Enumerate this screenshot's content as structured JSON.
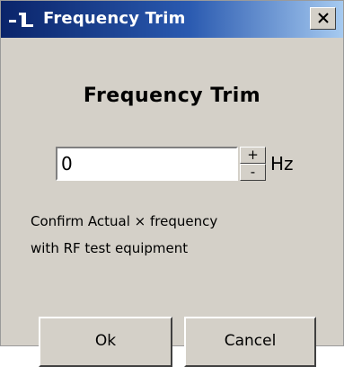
{
  "window": {
    "title": "Frequency Trim",
    "icon": "radio-app-icon",
    "close_icon": "close-x-icon"
  },
  "dialog": {
    "heading": "Frequency Trim",
    "input_value": "0",
    "spin_up": "+",
    "spin_down": "-",
    "unit": "Hz",
    "message_line1": "Confirm Actual  × frequency",
    "message_line2": "with RF test equipment"
  },
  "buttons": {
    "ok_label": "Ok",
    "cancel_label": "Cancel"
  },
  "colors": {
    "titlebar_start": "#0a246a",
    "titlebar_end": "#a6caf0",
    "dialog_bg": "#d4d0c8"
  }
}
